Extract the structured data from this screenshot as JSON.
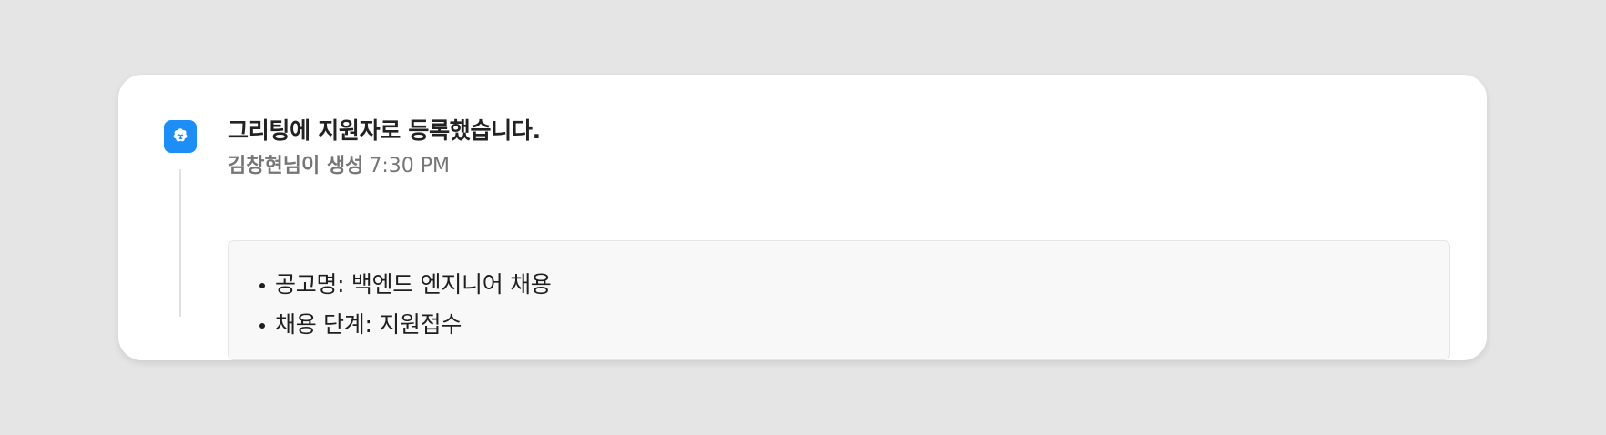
{
  "activity": {
    "app_icon": "greeting-logo-icon",
    "accent_color": "#1d8ef5",
    "title": "그리팅에 지원자로 등록했습니다.",
    "author": "김창현님이 생성",
    "time": "7:30 PM",
    "details": [
      {
        "text": "공고명: 백엔드 엔지니어 채용"
      },
      {
        "text": "채용 단계: 지원접수"
      }
    ]
  }
}
